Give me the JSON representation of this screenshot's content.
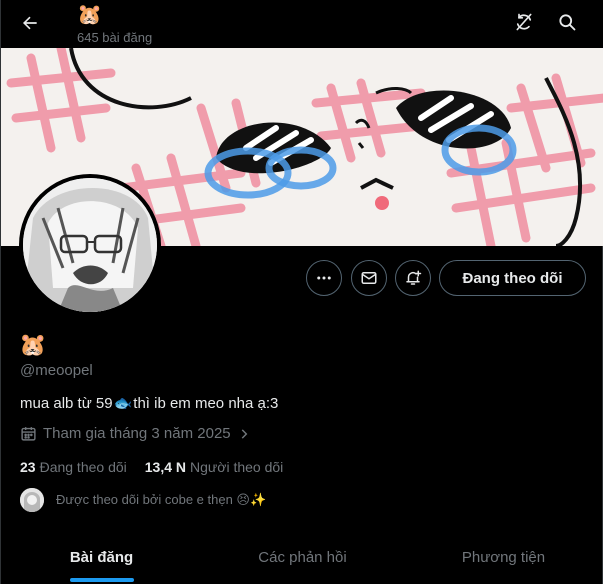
{
  "header": {
    "title_emoji": "🐹",
    "post_count": "645 bài đăng",
    "back_icon": "arrow-left-icon",
    "icons": [
      "rotate-slash-icon",
      "search-icon"
    ]
  },
  "profile": {
    "name_emoji": "🐹",
    "handle": "@meoopel",
    "bio_before": "mua alb từ 59",
    "bio_fish": "🐟",
    "bio_after": " thì ib em meo nha ạ:3",
    "joined": "Tham gia tháng 3 năm 2025",
    "following_count": "23",
    "following_label": "Đang theo dõi",
    "followers_count": "13,4 N",
    "followers_label": "Người theo dõi",
    "followed_by": "Được theo dõi bởi cobe e thẹn 😣✨"
  },
  "actions": {
    "follow_label": "Đang theo dõi",
    "icons": [
      "more-icon",
      "message-icon",
      "notification-plus-icon"
    ]
  },
  "tabs": [
    {
      "label": "Bài đăng",
      "active": true
    },
    {
      "label": "Các phản hồi",
      "active": false
    },
    {
      "label": "Phương tiện",
      "active": false
    }
  ],
  "colors": {
    "accent": "#1d9bf0",
    "background": "#000000",
    "text": "#e7e9ea",
    "muted": "#71767b"
  }
}
